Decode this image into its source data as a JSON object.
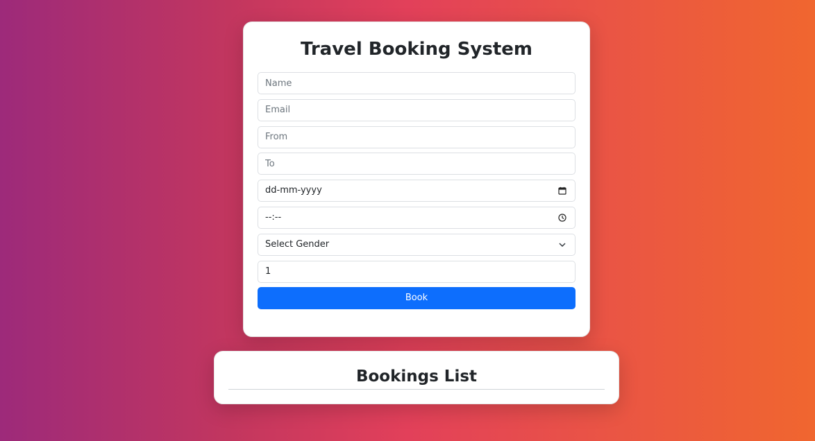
{
  "form": {
    "title": "Travel Booking System",
    "name_placeholder": "Name",
    "email_placeholder": "Email",
    "from_placeholder": "From",
    "to_placeholder": "To",
    "date_value": "dd-mm-yyyy",
    "time_value": "--:--",
    "gender_selected": "Select Gender",
    "passengers_value": "1",
    "book_label": "Book",
    "icons": {
      "date": "calendar-icon",
      "time": "clock-icon",
      "gender": "chevron-down-icon"
    }
  },
  "bookings": {
    "title": "Bookings List"
  },
  "colors": {
    "primary": "#0d6efd",
    "gradient_start": "#9d2a7a",
    "gradient_mid": "#e2405a",
    "gradient_end": "#f0662f"
  }
}
